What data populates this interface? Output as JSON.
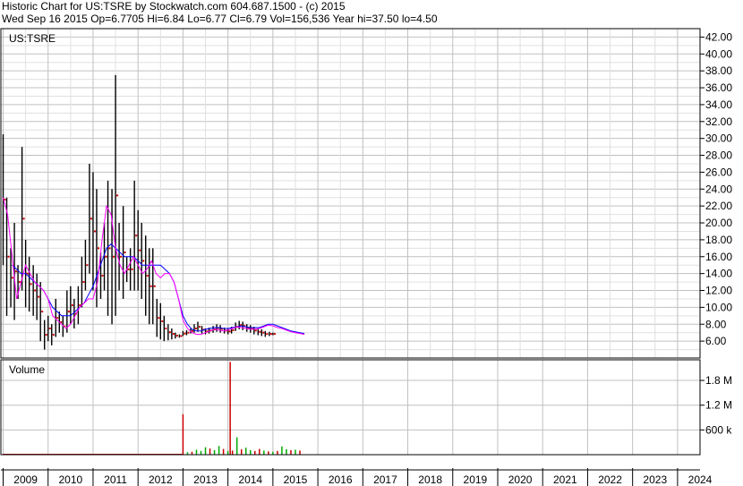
{
  "header": {
    "line1": "Historic Chart for US:TSRE by Stockwatch.com 604.687.1500 - (c) 2015",
    "line2": "Wed Sep 16 2015   Op=6.7705  Hi=6.84  Lo=6.77  Cl=6.79  Vol=156,536  Year hi=37.50  lo=4.50"
  },
  "colors": {
    "background": "#ffffff",
    "grid": "#c0c0c0",
    "price_bars": "#000000",
    "ma_short": "#ff00ff",
    "ma_long": "#0000ff",
    "close_dots": "#cc0000",
    "volume_up": "#00aa00",
    "volume_down": "#cc0000"
  },
  "chart_data": [
    {
      "type": "line",
      "title": "US:TSRE",
      "x_tick_labels": [
        "2009",
        "2010",
        "2011",
        "2012",
        "2013",
        "2014",
        "2015",
        "2016",
        "2017",
        "2018",
        "2019",
        "2020",
        "2021",
        "2022",
        "2023",
        "2024"
      ],
      "y_tick_labels": [
        "42.00",
        "40.00",
        "38.00",
        "36.00",
        "34.00",
        "32.00",
        "30.00",
        "28.00",
        "26.00",
        "24.00",
        "22.00",
        "20.00",
        "18.00",
        "16.00",
        "14.00",
        "12.00",
        "10.00",
        "8.00",
        "6.00"
      ],
      "ylim": [
        4,
        43
      ],
      "xlim": [
        2008.95,
        2024.5
      ],
      "grid": true,
      "series": [
        {
          "kind": "high-low bars",
          "x": [
            2009.0,
            2009.08,
            2009.17,
            2009.25,
            2009.33,
            2009.42,
            2009.5,
            2009.58,
            2009.67,
            2009.75,
            2009.83,
            2009.92,
            2010.0,
            2010.08,
            2010.17,
            2010.25,
            2010.33,
            2010.42,
            2010.5,
            2010.58,
            2010.67,
            2010.75,
            2010.83,
            2010.92,
            2011.0,
            2011.08,
            2011.17,
            2011.25,
            2011.33,
            2011.42,
            2011.5,
            2011.58,
            2011.67,
            2011.75,
            2011.83,
            2011.92,
            2012.0,
            2012.08,
            2012.17,
            2012.25,
            2012.33,
            2012.42,
            2012.5,
            2012.58,
            2012.67,
            2012.75,
            2012.83,
            2012.92,
            2013.0,
            2013.08,
            2013.17,
            2013.25,
            2013.33,
            2013.42,
            2013.5,
            2013.58,
            2013.67,
            2013.75,
            2013.83,
            2013.92,
            2014.0,
            2014.08,
            2014.17,
            2014.25,
            2014.33,
            2014.42,
            2014.5,
            2014.58,
            2014.67,
            2014.75,
            2014.83,
            2014.92,
            2015.0,
            2015.08,
            2015.17,
            2015.25,
            2015.33,
            2015.42,
            2015.5,
            2015.58,
            2015.67
          ],
          "high": [
            30.5,
            23.0,
            17.0,
            20.0,
            15.0,
            29.0,
            18.0,
            16.0,
            15.0,
            14.0,
            13.0,
            8.5,
            9.0,
            8.0,
            11.0,
            9.5,
            9.0,
            12.0,
            12.5,
            11.0,
            12.5,
            16.0,
            18.0,
            27.0,
            26.0,
            24.0,
            16.5,
            20.0,
            25.0,
            24.0,
            37.5,
            20.0,
            22.0,
            16.0,
            17.0,
            25.0,
            21.5,
            20.0,
            18.5,
            17.0,
            17.0,
            11.0,
            10.5,
            9.0,
            8.0,
            7.5,
            7.0,
            6.8,
            7.2,
            7.3,
            7.5,
            8.0,
            8.3,
            7.8,
            7.5,
            7.6,
            7.8,
            8.0,
            7.9,
            7.6,
            7.5,
            7.7,
            8.2,
            8.4,
            8.3,
            8.0,
            7.9,
            7.7,
            7.5,
            7.4,
            7.2,
            7.1,
            7.0
          ],
          "low": [
            15.0,
            9.0,
            10.0,
            8.5,
            11.0,
            12.0,
            10.0,
            9.5,
            9.0,
            8.5,
            6.0,
            5.0,
            6.0,
            5.5,
            6.5,
            7.0,
            6.5,
            7.0,
            8.0,
            7.5,
            8.0,
            10.0,
            12.0,
            14.0,
            12.0,
            10.0,
            11.0,
            12.0,
            9.0,
            8.0,
            9.0,
            12.0,
            11.0,
            13.0,
            12.0,
            12.0,
            12.0,
            11.0,
            9.0,
            8.0,
            8.0,
            6.5,
            6.2,
            6.0,
            6.1,
            6.2,
            6.3,
            6.4,
            6.6,
            6.7,
            6.9,
            7.0,
            7.1,
            6.9,
            6.8,
            6.9,
            7.0,
            7.1,
            7.0,
            6.9,
            6.8,
            6.9,
            7.2,
            7.4,
            7.3,
            7.1,
            7.0,
            6.8,
            6.7,
            6.6,
            6.5,
            6.6,
            6.7
          ]
        },
        {
          "name": "",
          "kind": "short moving average",
          "x": [
            2009.0,
            2009.1,
            2009.2,
            2009.3,
            2009.4,
            2009.5,
            2009.6,
            2009.7,
            2009.8,
            2009.9,
            2010.0,
            2010.1,
            2010.2,
            2010.3,
            2010.4,
            2010.5,
            2010.6,
            2010.7,
            2010.8,
            2010.9,
            2011.0,
            2011.1,
            2011.2,
            2011.3,
            2011.4,
            2011.5,
            2011.6,
            2011.7,
            2011.8,
            2011.9,
            2012.0,
            2012.1,
            2012.2,
            2012.3,
            2012.4,
            2012.5,
            2012.6,
            2012.7,
            2012.8,
            2012.9,
            2013.0,
            2013.1,
            2013.2,
            2013.3,
            2013.4,
            2013.5,
            2013.6,
            2013.7,
            2013.8,
            2013.9,
            2014.0,
            2014.1,
            2014.2,
            2014.3,
            2014.4,
            2014.5,
            2014.6,
            2014.7,
            2014.8,
            2014.9,
            2015.0,
            2015.1,
            2015.2,
            2015.3,
            2015.4,
            2015.5,
            2015.6,
            2015.7
          ],
          "values": [
            23.0,
            21.0,
            16.0,
            11.0,
            13.0,
            15.0,
            14.0,
            13.0,
            12.5,
            12.0,
            11.0,
            9.0,
            8.5,
            8.0,
            7.5,
            8.0,
            9.0,
            10.0,
            10.5,
            11.0,
            11.0,
            13.0,
            18.0,
            22.0,
            21.0,
            17.0,
            15.0,
            14.0,
            15.0,
            16.0,
            15.0,
            14.0,
            14.5,
            15.5,
            14.0,
            13.5,
            14.0,
            14.0,
            13.0,
            11.0,
            8.5,
            7.5,
            7.0,
            6.8,
            6.8,
            7.0,
            7.2,
            7.4,
            7.3,
            7.2,
            7.3,
            7.5,
            7.7,
            7.6,
            7.5,
            7.4,
            7.4,
            7.5,
            7.7,
            7.9,
            7.8,
            7.6,
            7.5,
            7.3,
            7.1,
            7.0,
            6.9,
            6.8
          ]
        },
        {
          "name": "",
          "kind": "long moving average",
          "x": [
            2009.2,
            2009.3,
            2009.4,
            2009.5,
            2009.6,
            2009.7,
            2009.8,
            2009.9,
            2010.0,
            2010.1,
            2010.2,
            2010.3,
            2010.4,
            2010.5,
            2010.6,
            2010.7,
            2010.8,
            2010.9,
            2011.0,
            2011.1,
            2011.2,
            2011.3,
            2011.4,
            2011.5,
            2011.6,
            2011.7,
            2011.8,
            2011.9,
            2012.0,
            2012.1,
            2012.2,
            2012.3,
            2012.4,
            2012.5,
            2012.6,
            2012.7,
            2012.8,
            2012.9,
            2013.0,
            2013.1,
            2013.2,
            2013.3,
            2013.4,
            2013.5,
            2013.6,
            2013.7,
            2013.8,
            2013.9,
            2014.0,
            2014.1,
            2014.2,
            2014.3,
            2014.4,
            2014.5,
            2014.6,
            2014.7,
            2014.8,
            2014.9,
            2015.0,
            2015.1,
            2015.2,
            2015.3,
            2015.4,
            2015.5,
            2015.6,
            2015.7
          ],
          "values": [
            15.0,
            14.5,
            14.0,
            14.0,
            13.5,
            13.0,
            12.5,
            12.0,
            11.0,
            10.0,
            9.5,
            9.0,
            9.0,
            9.0,
            9.5,
            10.0,
            10.5,
            11.5,
            12.5,
            14.0,
            15.5,
            17.0,
            17.5,
            17.0,
            16.5,
            16.0,
            16.0,
            16.0,
            15.5,
            15.0,
            15.0,
            15.0,
            15.0,
            15.0,
            14.5,
            14.0,
            13.0,
            11.0,
            9.0,
            8.0,
            7.4,
            7.2,
            7.2,
            7.4,
            7.5,
            7.6,
            7.6,
            7.5,
            7.5,
            7.6,
            7.7,
            7.8,
            7.7,
            7.6,
            7.6,
            7.6,
            7.8,
            8.0,
            8.0,
            7.8,
            7.6,
            7.4,
            7.2,
            7.1,
            7.0,
            6.9
          ]
        }
      ]
    },
    {
      "type": "bar",
      "title": "Volume",
      "y_tick_labels": [
        "1.8 M",
        "1.2 M",
        "600 k"
      ],
      "ylim": [
        0,
        2300000
      ],
      "grid": true,
      "x": [
        2013.0,
        2013.1,
        2013.2,
        2013.3,
        2013.4,
        2013.5,
        2013.6,
        2013.7,
        2013.8,
        2013.9,
        2014.0,
        2014.05,
        2014.1,
        2014.2,
        2014.3,
        2014.4,
        2014.5,
        2014.6,
        2014.7,
        2014.8,
        2014.9,
        2015.0,
        2015.1,
        2015.2,
        2015.3,
        2015.4,
        2015.5,
        2015.6
      ],
      "values": [
        980000,
        60000,
        70000,
        120000,
        90000,
        180000,
        150000,
        110000,
        210000,
        140000,
        90000,
        2250000,
        100000,
        420000,
        130000,
        170000,
        110000,
        90000,
        140000,
        100000,
        80000,
        70000,
        90000,
        200000,
        130000,
        110000,
        120000,
        100000
      ],
      "directions": [
        "down",
        "up",
        "down",
        "up",
        "up",
        "up",
        "down",
        "up",
        "up",
        "down",
        "up",
        "down",
        "down",
        "up",
        "down",
        "up",
        "up",
        "down",
        "down",
        "up",
        "down",
        "up",
        "down",
        "up",
        "up",
        "down",
        "up",
        "down"
      ],
      "baseline_volume": 20000,
      "baseline_range": [
        2009.0,
        2013.0
      ]
    }
  ]
}
